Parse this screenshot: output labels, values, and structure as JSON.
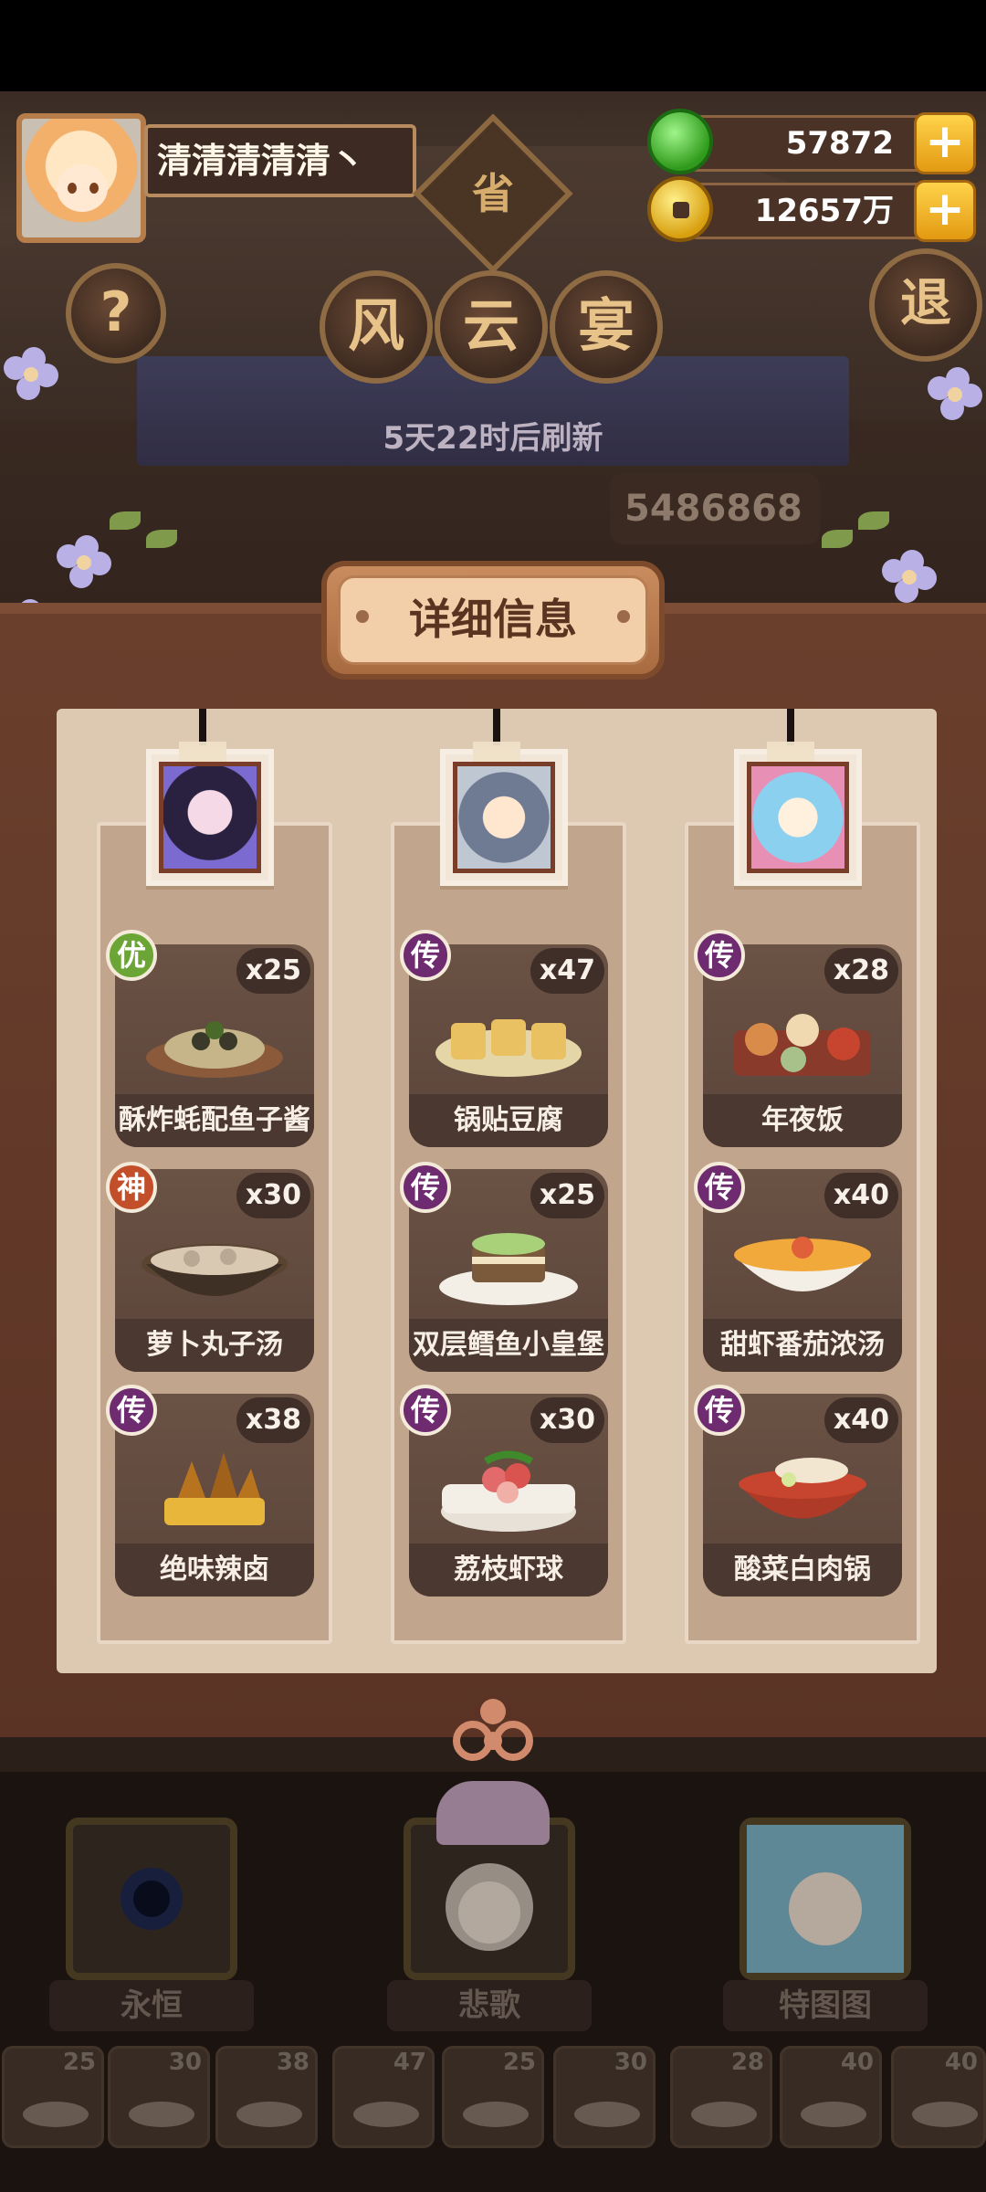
{
  "player": {
    "name": "清清清清清丶"
  },
  "currency": {
    "jade": {
      "value": "57872",
      "plus": "+"
    },
    "gold": {
      "value": "12657万",
      "plus": "+"
    }
  },
  "header": {
    "help": "?",
    "sheng": "省",
    "title_chars": [
      "风",
      "云",
      "宴"
    ],
    "exit": "退",
    "refresh": "5天22时后刷新",
    "score": "5486868"
  },
  "panel_title": "详细信息",
  "columns": [
    {
      "dishes": [
        {
          "badge": "优",
          "rarity": "you",
          "count": "x25",
          "name": "酥炸蚝配鱼子酱",
          "dish_color": "#c7b58a"
        },
        {
          "badge": "神",
          "rarity": "shen",
          "count": "x30",
          "name": "萝卜丸子汤",
          "dish_color": "#d9c9b3"
        },
        {
          "badge": "传",
          "rarity": "chuan",
          "count": "x38",
          "name": "绝味辣卤",
          "dish_color": "#b8731f"
        }
      ]
    },
    {
      "dishes": [
        {
          "badge": "传",
          "rarity": "chuan",
          "count": "x47",
          "name": "锅贴豆腐",
          "dish_color": "#e9c163"
        },
        {
          "badge": "传",
          "rarity": "chuan",
          "count": "x25",
          "name": "双层鳕鱼小皇堡",
          "dish_color": "#a8d17a"
        },
        {
          "badge": "传",
          "rarity": "chuan",
          "count": "x30",
          "name": "荔枝虾球",
          "dish_color": "#e26a6a"
        }
      ]
    },
    {
      "dishes": [
        {
          "badge": "传",
          "rarity": "chuan",
          "count": "x28",
          "name": "年夜饭",
          "dish_color": "#d98c4a"
        },
        {
          "badge": "传",
          "rarity": "chuan",
          "count": "x40",
          "name": "甜虾番茄浓汤",
          "dish_color": "#f2a93b"
        },
        {
          "badge": "传",
          "rarity": "chuan",
          "count": "x40",
          "name": "酸菜白肉锅",
          "dish_color": "#c7452f"
        }
      ]
    }
  ],
  "heroes": [
    {
      "label": "永恒"
    },
    {
      "label": "悲歌"
    },
    {
      "label": "特图图"
    }
  ],
  "slots": [
    "25",
    "30",
    "38",
    "47",
    "25",
    "30",
    "28",
    "40",
    "40"
  ]
}
